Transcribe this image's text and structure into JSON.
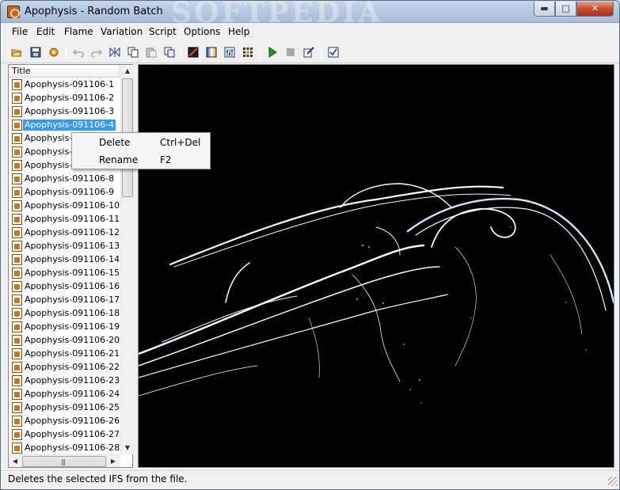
{
  "window": {
    "title": "Apophysis - Random Batch",
    "watermark": "SOFTPEDIA",
    "minimize_label": "▬",
    "maximize_label": "□",
    "close_label": "✕"
  },
  "menubar": {
    "items": [
      "File",
      "Edit",
      "Flame",
      "Variation",
      "Script",
      "Options",
      "Help"
    ]
  },
  "toolbar": {
    "icons": [
      "open-icon",
      "save-icon",
      "save-all-icon",
      "undo-icon",
      "redo-icon",
      "flip-icon",
      "copy-icon",
      "paste-icon",
      "duplicate-icon",
      "editor-icon",
      "gradient-icon",
      "adjust-icon",
      "mutate-icon",
      "play-icon",
      "stop-icon",
      "script-edit-icon",
      "options-icon"
    ]
  },
  "list": {
    "header": "Title",
    "items": [
      "Apophysis-091106-1",
      "Apophysis-091106-2",
      "Apophysis-091106-3",
      "Apophysis-091106-4",
      "Apophysis-091106-5",
      "Apophysis-091106-6",
      "Apophysis-091106-7",
      "Apophysis-091106-8",
      "Apophysis-091106-9",
      "Apophysis-091106-10",
      "Apophysis-091106-11",
      "Apophysis-091106-12",
      "Apophysis-091106-13",
      "Apophysis-091106-14",
      "Apophysis-091106-15",
      "Apophysis-091106-16",
      "Apophysis-091106-17",
      "Apophysis-091106-18",
      "Apophysis-091106-19",
      "Apophysis-091106-20",
      "Apophysis-091106-21",
      "Apophysis-091106-22",
      "Apophysis-091106-23",
      "Apophysis-091106-24",
      "Apophysis-091106-25",
      "Apophysis-091106-26",
      "Apophysis-091106-27",
      "Apophysis-091106-28"
    ],
    "selected_index": 3
  },
  "context_menu": {
    "items": [
      {
        "label": "Delete",
        "shortcut": "Ctrl+Del"
      },
      {
        "label": "Rename",
        "shortcut": "F2"
      }
    ]
  },
  "status": {
    "text": "Deletes the selected IFS from the file."
  },
  "colors": {
    "selection": "#3399ff",
    "preview_bg": "#000000",
    "fractal": "#e8f4ff"
  }
}
